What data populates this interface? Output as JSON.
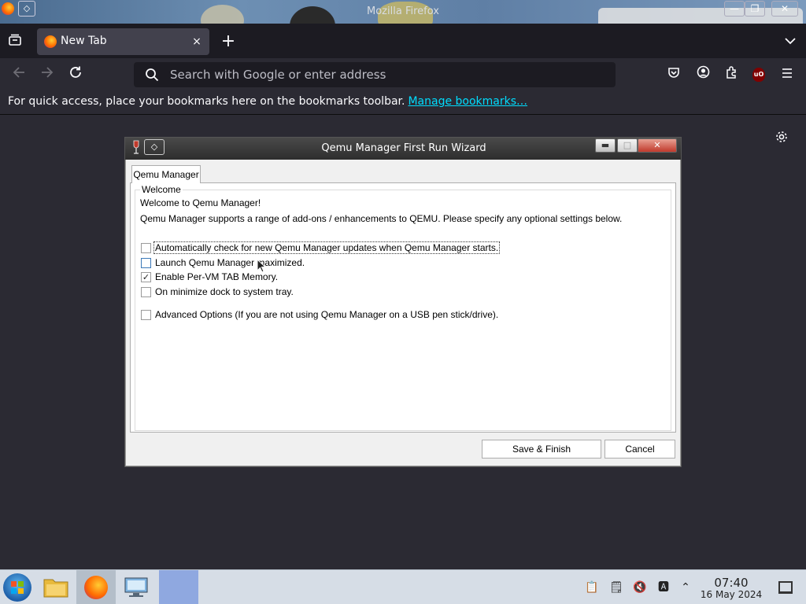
{
  "os_window": {
    "title": "Mozilla Firefox",
    "pin_symbol": "◇",
    "minimize_symbol": "—",
    "restore_symbol": "❐",
    "close_symbol": "✕"
  },
  "firefox": {
    "tab": {
      "title": "New Tab",
      "close_symbol": "×"
    },
    "newtab_symbol": "+",
    "alltabs_symbol": "⌄",
    "urlbar": {
      "placeholder": "Search with Google or enter address"
    },
    "bookmarks_bar": {
      "message": "For quick access, place your bookmarks here on the bookmarks toolbar.",
      "link": "Manage bookmarks…"
    },
    "ublock_label": "uO",
    "icons": [
      "tab-list-icon",
      "back-arrow-icon",
      "forward-arrow-icon",
      "reload-icon",
      "search-icon",
      "pocket-icon",
      "account-icon",
      "extensions-icon",
      "ublock-icon",
      "hamburger-menu-icon",
      "settings-gear-icon"
    ]
  },
  "wizard": {
    "title": "Qemu Manager First Run Wizard",
    "tab_label": "Qemu Manager",
    "group_title": "Welcome",
    "welcome_line": "Welcome to Qemu Manager!",
    "intro_line": "Qemu Manager supports a range of add-ons / enhancements to QEMU.  Please specify any optional settings below.",
    "options": [
      {
        "label": "Automatically check for new Qemu Manager updates when Qemu Manager starts.",
        "checked": false
      },
      {
        "label": "Launch Qemu Manager maximized.",
        "checked": false
      },
      {
        "label": "Enable Per-VM TAB Memory.",
        "checked": true
      },
      {
        "label": "On minimize dock to system tray.",
        "checked": false
      },
      {
        "label": "Advanced Options (If you are not using Qemu Manager on a USB pen stick/drive).",
        "checked": false
      }
    ],
    "buttons": {
      "save": "Save & Finish",
      "cancel": "Cancel"
    },
    "minimize_symbol": "▬",
    "maximize_symbol": "□",
    "close_symbol": "✕",
    "check_mark": "✓"
  },
  "taskbar": {
    "clock_time": "07:40",
    "clock_date": "16 May 2024",
    "tray_icons": [
      "clipboard-icon",
      "notes-icon",
      "volume-muted-icon",
      "input-method-icon",
      "chevron-up-icon"
    ],
    "tray_symbols": {
      "clipboard": "📋",
      "notes": "🗒",
      "volume": "🔇",
      "input": "🅰",
      "chevron": "⌃"
    }
  }
}
